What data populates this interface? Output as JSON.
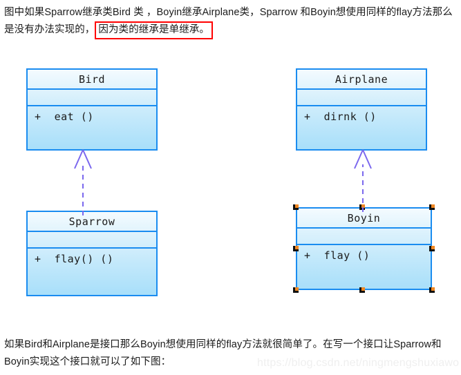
{
  "document": {
    "intro_paragraph": {
      "before_highlight": "图中如果Sparrow继承类Bird 类 ，Boyin继承Airplane类，Sparrow 和Boyin想使用同样的flay方法那么是没有办法实现的，",
      "highlight": "因为类的继承是单继承。",
      "highlight_border_color": "#ff0000"
    },
    "outro_paragraph": "如果Bird和Airplane是接口那么Boyin想使用同样的flay方法就很简单了。在写一个接口让Sparrow和Boyin实现这个接口就可以了如下图："
  },
  "diagram": {
    "type": "uml-class-diagram",
    "box_border_color": "#1a8cf0",
    "box_fill_top": "#f4fbfe",
    "box_fill_bottom": "#a8dffa",
    "connector_color": "#7b68ee",
    "connector_style": "dashed-hollow-triangle",
    "classes": [
      {
        "id": "bird",
        "name": "Bird",
        "attributes": [],
        "operations": [
          "+  eat ()"
        ],
        "selected": false
      },
      {
        "id": "sparrow",
        "name": "Sparrow",
        "attributes": [],
        "operations": [
          "+  flay() ()"
        ],
        "selected": false
      },
      {
        "id": "airplane",
        "name": "Airplane",
        "attributes": [],
        "operations": [
          "+  dirnk ()"
        ],
        "selected": false
      },
      {
        "id": "boyin",
        "name": "Boyin",
        "attributes": [],
        "operations": [
          "+  flay ()"
        ],
        "selected": true
      }
    ],
    "relations": [
      {
        "from": "Sparrow",
        "to": "Bird",
        "kind": "realization"
      },
      {
        "from": "Boyin",
        "to": "Airplane",
        "kind": "realization"
      }
    ],
    "selection_handle_color": "#111111",
    "selection_handle_accent": "#f08722"
  },
  "watermark": {
    "text": "https://blog.csdn.net/ningmengshuxiawo"
  }
}
